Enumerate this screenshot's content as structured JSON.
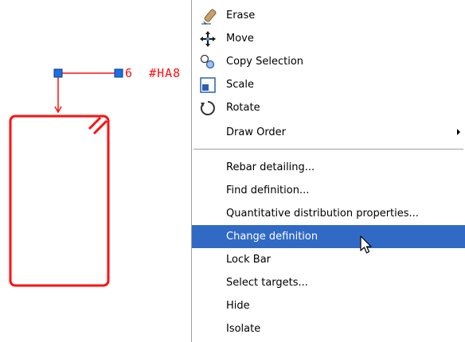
{
  "drawing": {
    "rebar_count": "6",
    "rebar_type": "#HA8",
    "stroke_color": "#ff1010",
    "grip_color": "#1e6fe0"
  },
  "menu": {
    "highlight_color": "#316ac5",
    "items": [
      {
        "label": "Erase",
        "icon": "eraser-icon"
      },
      {
        "label": "Move",
        "icon": "move-arrows-icon"
      },
      {
        "label": "Copy Selection",
        "icon": "copy-circles-icon"
      },
      {
        "label": "Scale",
        "icon": "scale-icon"
      },
      {
        "label": "Rotate",
        "icon": "rotate-icon"
      },
      {
        "label": "Draw Order",
        "icon": "",
        "submenu": true
      },
      {
        "label": "Rebar detailing..."
      },
      {
        "label": "Find definition..."
      },
      {
        "label": "Quantitative distribution properties..."
      },
      {
        "label": "Change definition",
        "highlighted": true
      },
      {
        "label": "Lock Bar"
      },
      {
        "label": "Select targets..."
      },
      {
        "label": "Hide"
      },
      {
        "label": "Isolate"
      }
    ]
  }
}
